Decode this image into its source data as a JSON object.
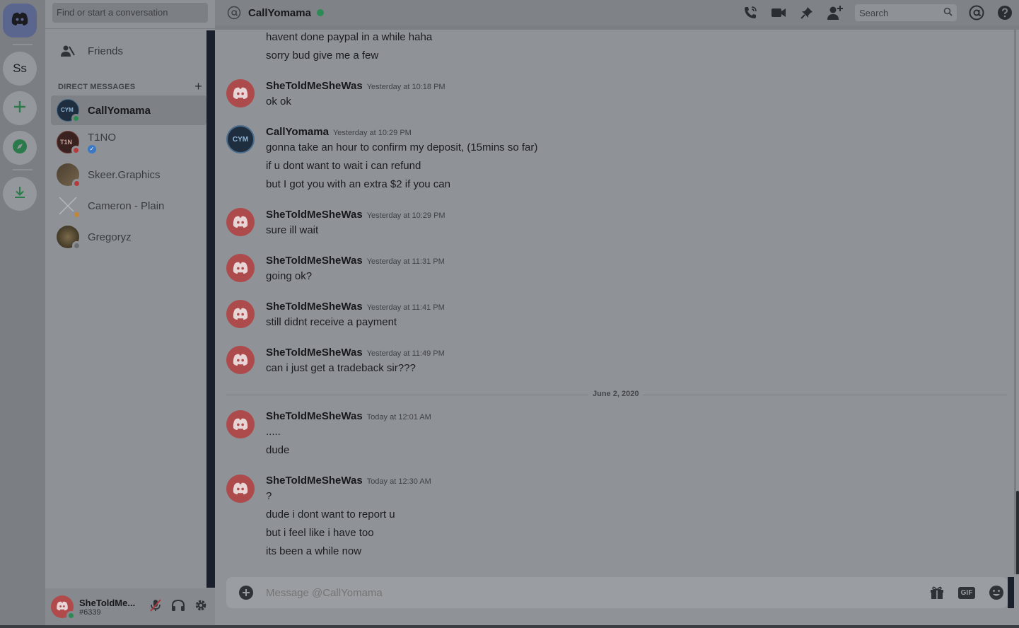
{
  "sidebar": {
    "search_placeholder": "Find or start a conversation",
    "friends_label": "Friends",
    "dm_header": "DIRECT MESSAGES",
    "dm_add": "+",
    "dms": [
      {
        "name": "CallYomama",
        "status": "online",
        "active": true
      },
      {
        "name": "T1NO",
        "status": "dnd",
        "verified": true
      },
      {
        "name": "Skeer.Graphics",
        "status": "dnd"
      },
      {
        "name": "Cameron - Plain",
        "status": "idle"
      },
      {
        "name": "Gregoryz",
        "status": "offline"
      }
    ]
  },
  "servers": {
    "ss_label": "Ss"
  },
  "user": {
    "name": "SheToldMe...",
    "tag": "#6339"
  },
  "header": {
    "channel_name": "CallYomama",
    "search_placeholder": "Search"
  },
  "messages": {
    "cont_lines": [
      "havent done paypal in a while haha",
      "sorry bud give me a few"
    ],
    "groups": [
      {
        "author": "SheToldMeSheWas",
        "time": "Yesterday at 10:18 PM",
        "lines": [
          "ok ok"
        ]
      },
      {
        "author": "CallYomama",
        "time": "Yesterday at 10:29 PM",
        "lines": [
          "gonna take an hour to confirm my deposit, (15mins so far)",
          "if u dont want to wait i can refund",
          "but I got you with an extra $2 if you can"
        ]
      },
      {
        "author": "SheToldMeSheWas",
        "time": "Yesterday at 10:29 PM",
        "lines": [
          "sure ill wait"
        ]
      },
      {
        "author": "SheToldMeSheWas",
        "time": "Yesterday at 11:31 PM",
        "lines": [
          "going ok?"
        ]
      },
      {
        "author": "SheToldMeSheWas",
        "time": "Yesterday at 11:41 PM",
        "lines": [
          "still didnt receive a payment"
        ]
      },
      {
        "author": "SheToldMeSheWas",
        "time": "Yesterday at 11:49 PM",
        "lines": [
          "can i just get a tradeback sir???"
        ]
      },
      {
        "author": "SheToldMeSheWas",
        "time": "Today at 12:01 AM",
        "lines": [
          ".....",
          "dude"
        ]
      },
      {
        "author": "SheToldMeSheWas",
        "time": "Today at 12:30 AM",
        "lines": [
          "?",
          "dude i dont want to report u",
          "but i feel like i have too",
          "its been a while now"
        ]
      }
    ],
    "date_divider": "June 2, 2020"
  },
  "composer": {
    "placeholder": "Message @CallYomama",
    "gif_label": "GIF"
  },
  "colors": {
    "online": "#2d8a55",
    "dnd": "#b8393b",
    "idle": "#c0863a",
    "brand": "#5b668f",
    "avatar_red": "#ad4a4b"
  }
}
